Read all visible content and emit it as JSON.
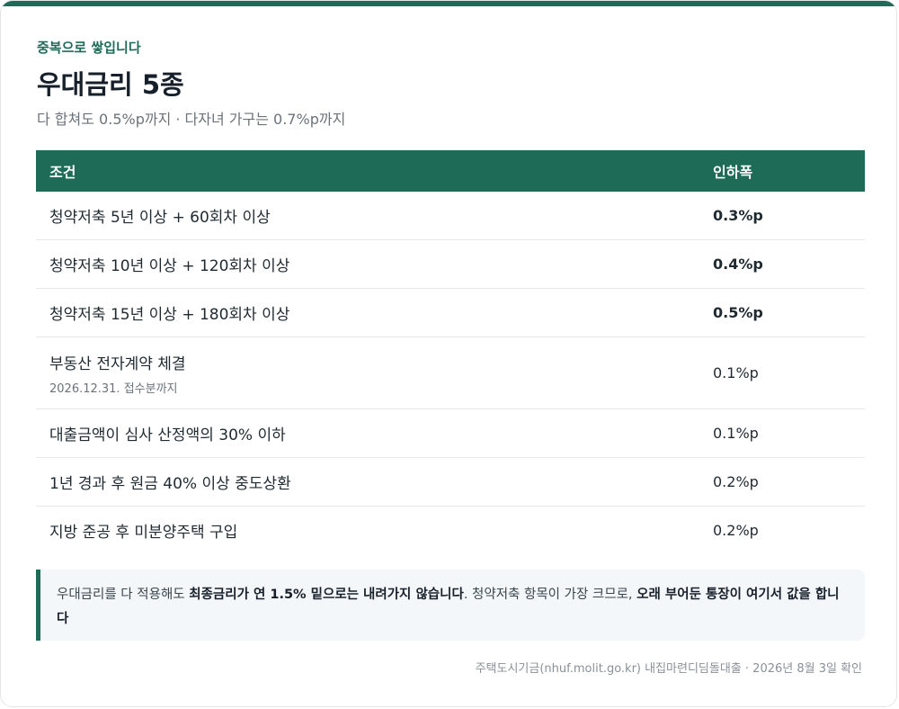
{
  "header": {
    "eyebrow": "중복으로 쌓입니다",
    "title": "우대금리 5종",
    "subtitle": "다 합쳐도 0.5%p까지 · 다자녀 가구는 0.7%p까지"
  },
  "table": {
    "columns": [
      "조건",
      "인하폭"
    ],
    "rows": [
      {
        "condition": "청약저축 5년 이상 + 60회차 이상",
        "note": "",
        "cut": "0.3%p",
        "emphasis": true
      },
      {
        "condition": "청약저축 10년 이상 + 120회차 이상",
        "note": "",
        "cut": "0.4%p",
        "emphasis": true
      },
      {
        "condition": "청약저축 15년 이상 + 180회차 이상",
        "note": "",
        "cut": "0.5%p",
        "emphasis": true
      },
      {
        "condition": "부동산 전자계약 체결",
        "note": "2026.12.31. 접수분까지",
        "cut": "0.1%p",
        "emphasis": false
      },
      {
        "condition": "대출금액이 심사 산정액의 30% 이하",
        "note": "",
        "cut": "0.1%p",
        "emphasis": false
      },
      {
        "condition": "1년 경과 후 원금 40% 이상 중도상환",
        "note": "",
        "cut": "0.2%p",
        "emphasis": false
      },
      {
        "condition": "지방 준공 후 미분양주택 구입",
        "note": "",
        "cut": "0.2%p",
        "emphasis": false
      }
    ]
  },
  "note": {
    "part1": "우대금리를 다 적용해도 ",
    "bold1": "최종금리가 연 1.5% 밑으로는 내려가지 않습니다",
    "part2": ". 청약저축 항목이 가장 크므로, ",
    "bold2": "오래 부어둔 통장이 여기서 값을 합니다"
  },
  "footer": "주택도시기금(nhuf.molit.go.kr) 내집마련디딤돌대출 · 2026년 8월 3일 확인",
  "colors": {
    "accent": "#1e6b57"
  }
}
